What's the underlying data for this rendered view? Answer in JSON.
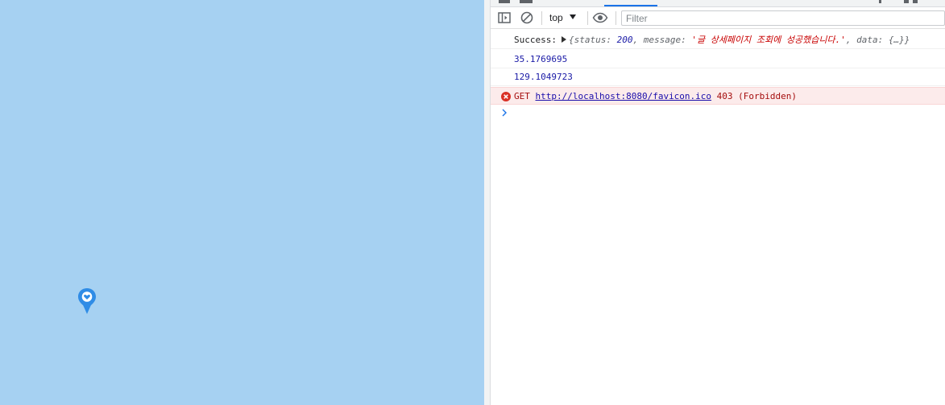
{
  "devtools": {
    "toolbar": {
      "context_label": "top",
      "filter_placeholder": "Filter"
    },
    "console": {
      "success_log": {
        "label": "Success:",
        "obj_open": "{",
        "status_key": "status:",
        "status_value": "200",
        "sep1": ",",
        "message_key": "message:",
        "message_value": "'글 상세페이지 조회에 성공했습니다.'",
        "sep2": ",",
        "data_key": "data:",
        "data_value": "{…}",
        "obj_close": "}"
      },
      "latitude_log": "35.1769695",
      "longitude_log": "129.1049723",
      "error_log": {
        "method": "GET",
        "url": "http://localhost:8080/favicon.ico",
        "status_text": "403 (Forbidden)"
      }
    }
  },
  "colors": {
    "map_water": "#a6d1f2",
    "marker": "#2f8ce6",
    "accent": "#1a73e8",
    "error_bg": "#fcebeb",
    "error_icon": "#d93025"
  },
  "icons": [
    "map-marker-icon",
    "sidebar-toggle-icon",
    "clear-console-icon",
    "dropdown-arrow-icon",
    "live-expression-eye-icon",
    "error-icon",
    "prompt-chevron-icon"
  ]
}
